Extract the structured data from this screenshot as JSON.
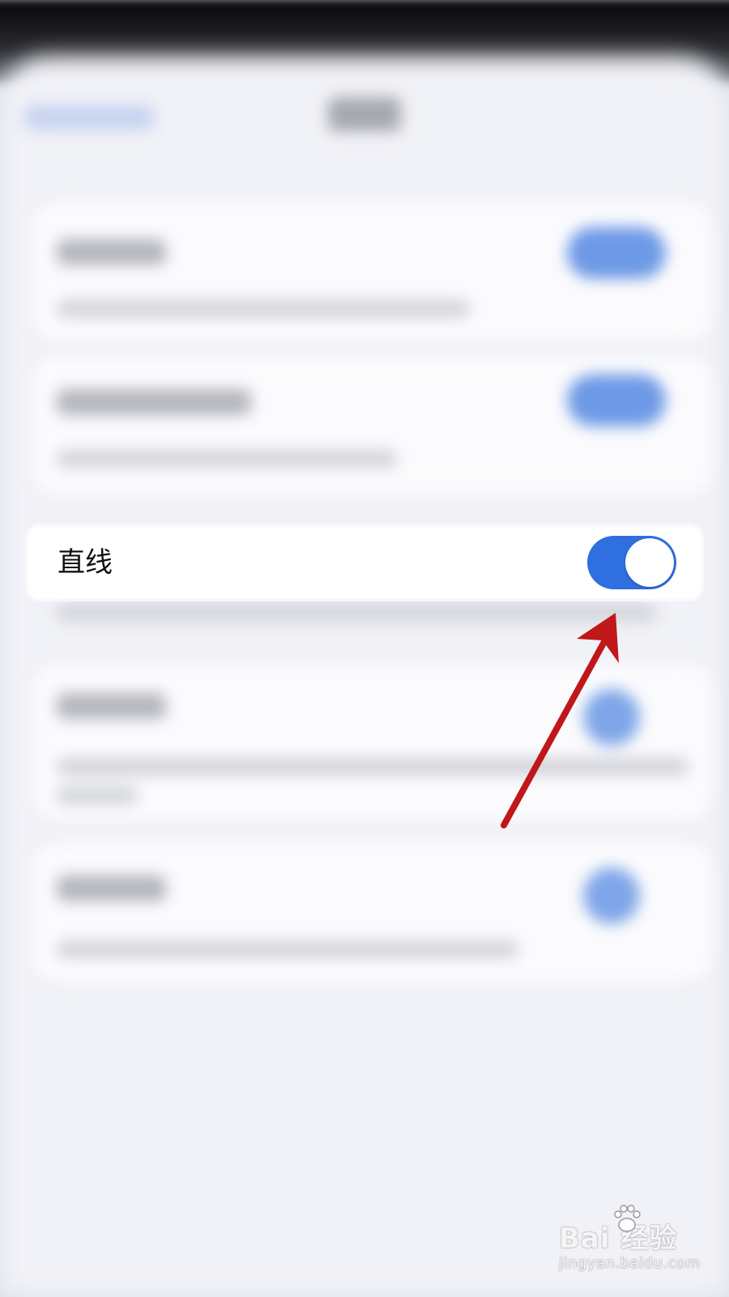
{
  "setting_row": {
    "label": "直线",
    "toggle_state": "on"
  },
  "colors": {
    "toggle_on": "#2f6fe0",
    "annotation_arrow": "#c0171a",
    "background": "#f1f2f7"
  },
  "watermark": {
    "brand": "Bai  经验",
    "url": "jingyan.baidu.com"
  }
}
